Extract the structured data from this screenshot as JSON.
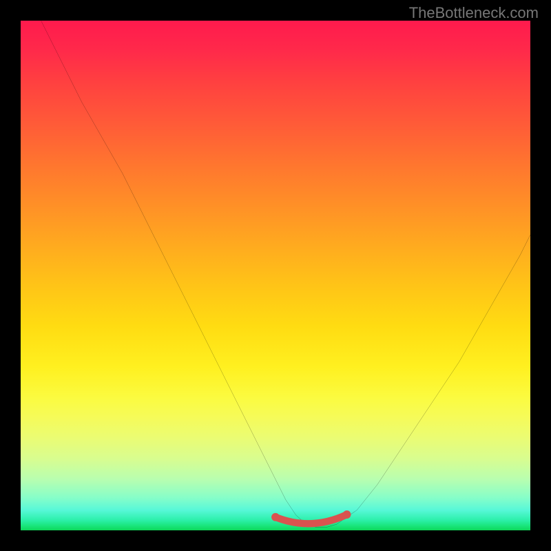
{
  "watermark": "TheBottleneck.com",
  "chart_data": {
    "type": "line",
    "title": "",
    "xlabel": "",
    "ylabel": "",
    "xlim": [
      0,
      100
    ],
    "ylim": [
      0,
      100
    ],
    "grid": false,
    "series": [
      {
        "name": "bottleneck-curve",
        "x": [
          4,
          8,
          12,
          16,
          20,
          24,
          28,
          32,
          36,
          40,
          44,
          48,
          50,
          52,
          54,
          56,
          58,
          60,
          62,
          66,
          70,
          74,
          78,
          82,
          86,
          90,
          94,
          98,
          100
        ],
        "y": [
          100,
          92,
          84,
          77,
          70,
          62,
          54,
          46,
          38,
          30,
          22,
          14,
          10,
          6,
          3,
          1.2,
          0.6,
          0.6,
          1.2,
          4,
          9,
          15,
          21,
          27,
          33,
          40,
          47,
          54,
          58
        ]
      }
    ],
    "accent_band": {
      "name": "trough-highlight",
      "color": "#d9534f",
      "x_start": 50,
      "x_end": 64,
      "y": 0.6
    },
    "gradient_scale": [
      {
        "pos": 0,
        "color": "#ff1a4d"
      },
      {
        "pos": 50,
        "color": "#ffc417"
      },
      {
        "pos": 80,
        "color": "#fbfb40"
      },
      {
        "pos": 100,
        "color": "#0ed85a"
      }
    ]
  }
}
